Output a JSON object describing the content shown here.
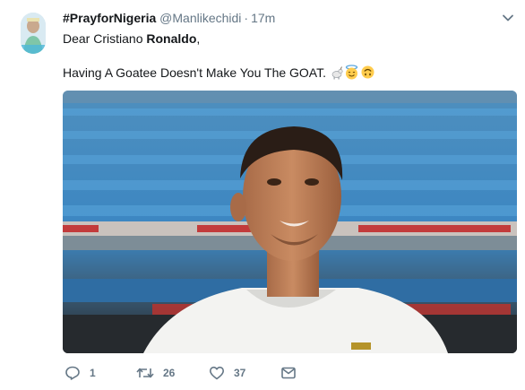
{
  "tweet": {
    "display_name": "#PrayforNigeria",
    "handle": "@Manlikechidi",
    "separator": "·",
    "time": "17m",
    "text_line1_prefix": "Dear Cristiano ",
    "text_line1_bold": "Ronaldo",
    "text_line1_suffix": ",",
    "text_line2": "Having A Goatee Doesn't Make You The GOAT.",
    "emojis": [
      "goat-emoji",
      "smiling-face-with-halo-emoji",
      "upside-down-face-emoji"
    ]
  },
  "actions": {
    "reply_count": "1",
    "retweet_count": "26",
    "like_count": "37"
  },
  "icons": {
    "more": "chevron-down-icon",
    "reply": "reply-icon",
    "retweet": "retweet-icon",
    "like": "heart-icon",
    "message": "envelope-icon"
  },
  "colors": {
    "text": "#14171a",
    "secondary": "#657786",
    "stadium_blue": "#3a8fc4"
  }
}
